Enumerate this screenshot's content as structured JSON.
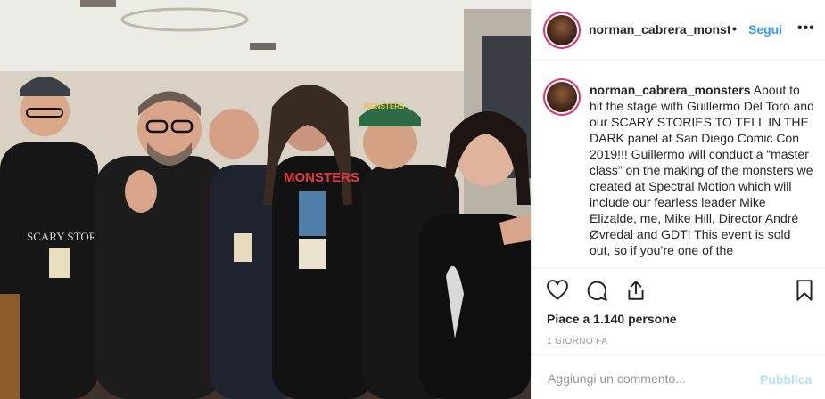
{
  "post": {
    "username": "norman_cabrera_monsters",
    "follow_label": "Segui",
    "separator": "•",
    "more_label": "•••"
  },
  "caption": {
    "username": "norman_cabrera_monsters",
    "text": "About to hit the stage with Guillermo Del Toro and our SCARY STORIES TO TELL IN THE DARK panel at San Diego Comic Con 2019!!! Guillermo will conduct a “master class” on the making of the monsters we created at Spectral Motion which will include our fearless leader Mike Elizalde, me, Mike Hill, Director André Øvredal and GDT! This event is sold out, so if you’re one of the"
  },
  "photo": {
    "shirt_text_left": "SCARY STORIES",
    "cap_text": "MONSTERS",
    "shirt_text_center": "MONSTERS"
  },
  "actions": {
    "icons": [
      "heart-icon",
      "comment-icon",
      "share-icon",
      "bookmark-icon"
    ]
  },
  "likes_text": "Piace a 1.140 persone",
  "time_text": "1 GIORNO FA",
  "comment": {
    "placeholder": "Aggiungi un commento...",
    "publish_label": "Pubblica"
  },
  "colors": {
    "link_blue": "#3897f0",
    "publish_disabled": "#b2dffc",
    "story_ring": "#e1306c"
  }
}
